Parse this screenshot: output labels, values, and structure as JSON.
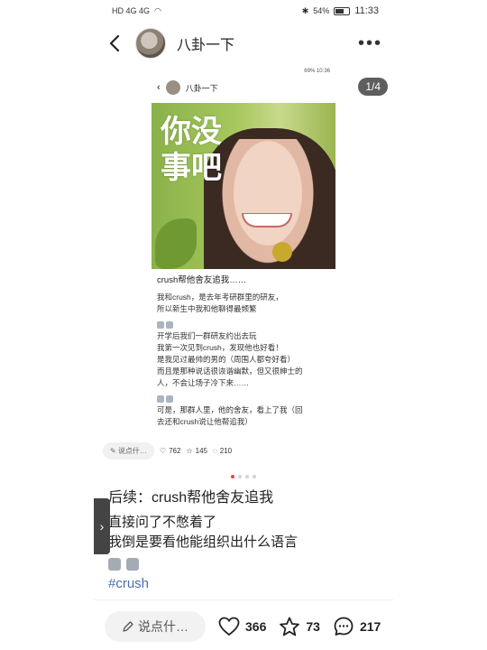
{
  "status_bar": {
    "left_icons": "HD 4G 4G",
    "battery_percent": "54%",
    "time": "11:33"
  },
  "header": {
    "author_name": "八卦一下"
  },
  "viewer": {
    "counter": "1/4",
    "screenshot": {
      "status_left": "",
      "status_right": "69% 10:36",
      "author_name": "八卦一下",
      "photo_text": "你没\n事吧",
      "post_title": "crush帮他舍友追我……",
      "paragraphs": [
        "我和crush，是去年考研群里的研友，",
        "所以新生中我和他聊得最频繁",
        "开学后我们一群研友约出去玩",
        "我第一次见到crush，发现他也好看！",
        "是我见过最帅的男的（周围人都夸好看）",
        "而且是那种说话很诙谐幽默，但又很绅士的",
        "人，不会让场子冷下来……",
        "可是，那群人里，他的舍友，看上了我（回",
        "去还和crush说让他帮追我）"
      ],
      "comment_placeholder": "说点什…",
      "likes": "762",
      "favorites": "145",
      "comments": "210"
    },
    "dots_total": 4,
    "dots_active": 0
  },
  "caption": {
    "title": "后续：crush帮他舍友追我",
    "lines": [
      "直接问了不憋着了",
      "我倒是要看他能组织出什么语言"
    ],
    "hashtag": "#crush"
  },
  "action_bar": {
    "comment_placeholder": "说点什…",
    "likes": "366",
    "favorites": "73",
    "comments": "217"
  },
  "colors": {
    "accent": "#ff3b48",
    "hashtag": "#4a6fb0"
  }
}
